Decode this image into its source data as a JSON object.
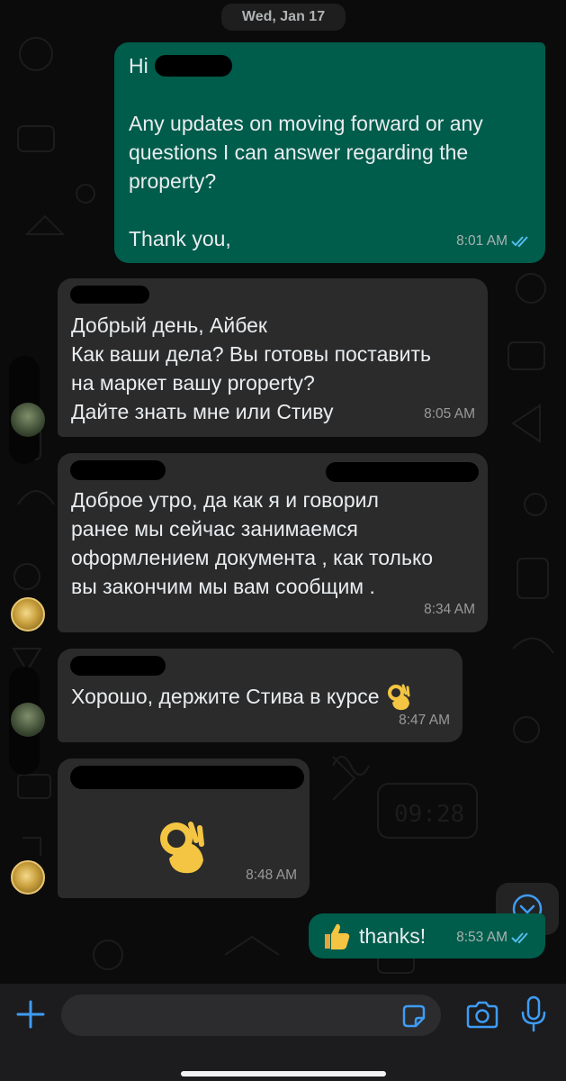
{
  "header": {
    "date": "Wed, Jan 17"
  },
  "messages": [
    {
      "direction": "outgoing",
      "sender_visible": false,
      "text": "Hi \n\nAny updates on moving forward or any\nquestions I can answer regarding the\nproperty?\n\nThank you,",
      "time": "8:01 AM",
      "status": "read"
    },
    {
      "direction": "incoming",
      "text": "Добрый день, Айбек\nКак ваши дела?  Вы готовы поставить\nна маркет вашу property?\nДайте знать мне или Стиву",
      "time": "8:05 AM"
    },
    {
      "direction": "incoming",
      "text": "Доброе утро, да как я и говорил\nранее мы сейчас занимаемся\nоформлением документа , как только\nвы закончим мы вам сообщим .",
      "time": "8:34 AM"
    },
    {
      "direction": "incoming",
      "text": "Хорошо, держите Стива в курсе",
      "emoji": "ok-hand",
      "time": "8:47 AM"
    },
    {
      "direction": "incoming",
      "emoji_only": "ok-hand",
      "time": "8:48 AM"
    },
    {
      "direction": "outgoing",
      "emoji": "thumbs-up",
      "text": "thanks!",
      "time": "8:53 AM",
      "status": "read"
    }
  ],
  "scroll_button": {
    "icon": "chevron-down-circle-icon"
  },
  "composer": {
    "placeholder": "",
    "icons": [
      "plus-icon",
      "sticker-icon",
      "camera-icon",
      "microphone-icon"
    ]
  },
  "colors": {
    "outgoing_bubble": "#005c4b",
    "incoming_bubble": "#2b2b2c",
    "read_ticks": "#53bdeb",
    "accent": "#3e9cf5",
    "background": "#0b0b0b"
  }
}
